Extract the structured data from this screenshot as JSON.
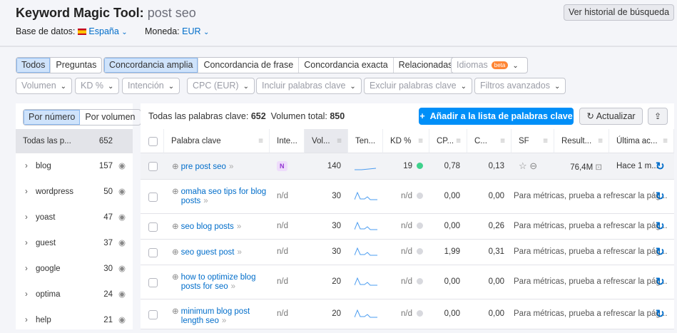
{
  "header": {
    "title": "Keyword Magic Tool:",
    "query": "post seo",
    "db_label": "Base de datos:",
    "db_value": "España",
    "currency_label": "Moneda:",
    "currency_value": "EUR",
    "history_button": "Ver historial de búsqueda"
  },
  "tabs_type": [
    "Todos",
    "Preguntas"
  ],
  "tabs_match": [
    "Concordancia amplia",
    "Concordancia de frase",
    "Concordancia exacta",
    "Relacionadas"
  ],
  "languages": {
    "label": "Idiomas",
    "badge": "beta"
  },
  "filters": [
    "Volumen",
    "KD %",
    "Intención",
    "CPC (EUR)",
    "Incluir palabras clave",
    "Excluir palabras clave",
    "Filtros avanzados"
  ],
  "left": {
    "sort_tabs": [
      "Por número",
      "Por volumen"
    ],
    "all_label": "Todas las p...",
    "all_count": "652",
    "groups": [
      {
        "name": "blog",
        "count": "157"
      },
      {
        "name": "wordpress",
        "count": "50"
      },
      {
        "name": "yoast",
        "count": "47"
      },
      {
        "name": "guest",
        "count": "37"
      },
      {
        "name": "google",
        "count": "30"
      },
      {
        "name": "optima",
        "count": "24"
      },
      {
        "name": "help",
        "count": "21"
      }
    ]
  },
  "summary": {
    "all_label": "Todas las palabras clave:",
    "all_count": "652",
    "vol_label": "Volumen total:",
    "vol_count": "850"
  },
  "buttons": {
    "add": "Añadir a la lista de palabras clave",
    "update": "Actualizar"
  },
  "columns": [
    "Palabra clave",
    "Inte...",
    "Vol...",
    "Ten...",
    "KD %",
    "CP...",
    "C...",
    "SF",
    "Result...",
    "Última ac..."
  ],
  "rows": [
    {
      "kw": "pre post seo",
      "kw2": "",
      "intent": "N",
      "vol": "140",
      "kd": "19",
      "kd_color": "#3fd18c",
      "cpc": "0,78",
      "com": "0,13",
      "results": "76,4M",
      "updated": "Hace 1 m..."
    },
    {
      "kw": "omaha seo tips for blog",
      "kw2": "posts",
      "intent": "n/d",
      "vol": "30",
      "kd": "n/d",
      "kd_color": "#d8d9de",
      "cpc": "0,00",
      "com": "0,00",
      "msg": "Para métricas, prueba a refrescar la pág..."
    },
    {
      "kw": "seo blog posts",
      "kw2": "",
      "intent": "n/d",
      "vol": "30",
      "kd": "n/d",
      "kd_color": "#d8d9de",
      "cpc": "0,00",
      "com": "0,26",
      "msg": "Para métricas, prueba a refrescar la pág..."
    },
    {
      "kw": "seo guest post",
      "kw2": "",
      "intent": "n/d",
      "vol": "30",
      "kd": "n/d",
      "kd_color": "#d8d9de",
      "cpc": "1,99",
      "com": "0,31",
      "msg": "Para métricas, prueba a refrescar la pág..."
    },
    {
      "kw": "how to optimize blog",
      "kw2": "posts for seo",
      "intent": "n/d",
      "vol": "20",
      "kd": "n/d",
      "kd_color": "#d8d9de",
      "cpc": "0,00",
      "com": "0,00",
      "msg": "Para métricas, prueba a refrescar la pág..."
    },
    {
      "kw": "minimum blog post",
      "kw2": "length seo",
      "intent": "n/d",
      "vol": "20",
      "kd": "n/d",
      "kd_color": "#d8d9de",
      "cpc": "0,00",
      "com": "0,00",
      "msg": "Para métricas, prueba a refrescar la pág..."
    }
  ]
}
